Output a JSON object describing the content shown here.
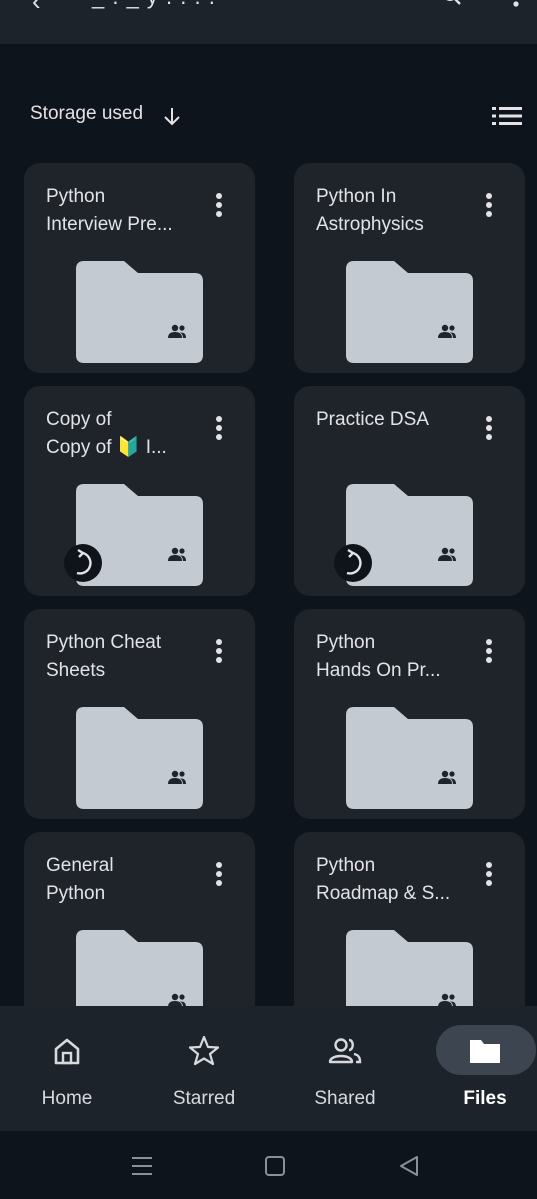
{
  "top_bar": {
    "back_glyph": "‹",
    "title": "_ . _ y . . . .",
    "search_icon": "search-icon",
    "more_icon": "more-vert-icon"
  },
  "sort": {
    "label": "Storage used",
    "direction_icon": "arrow-down-icon",
    "view_icon": "list-view-icon"
  },
  "folders": [
    {
      "title": "Python\nInterview Pre...",
      "shared": true,
      "syncing": false
    },
    {
      "title": "Python In\nAstrophysics",
      "shared": true,
      "syncing": false
    },
    {
      "title": "Copy of\nCopy of 🔰 I...",
      "shared": true,
      "syncing": true
    },
    {
      "title": "Practice DSA",
      "shared": true,
      "syncing": true
    },
    {
      "title": "Python Cheat\nSheets",
      "shared": true,
      "syncing": false
    },
    {
      "title": "Python\nHands On Pr...",
      "shared": true,
      "syncing": false
    },
    {
      "title": "General\nPython",
      "shared": true,
      "syncing": false
    },
    {
      "title": "Python\nRoadmap & S...",
      "shared": true,
      "syncing": false
    }
  ],
  "bottom_nav": {
    "items": [
      {
        "label": "Home",
        "icon": "home-icon"
      },
      {
        "label": "Starred",
        "icon": "star-icon"
      },
      {
        "label": "Shared",
        "icon": "people-icon"
      },
      {
        "label": "Files",
        "icon": "folder-icon",
        "active": true
      }
    ]
  },
  "colors": {
    "background": "#0e141b",
    "card": "#1f242b",
    "folder": "#c4cad1",
    "active_pill": "#3d4650"
  }
}
